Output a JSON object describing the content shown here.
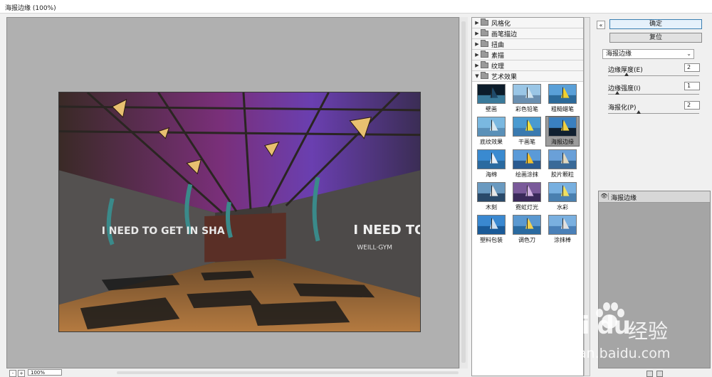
{
  "window": {
    "title": "海报边缘 (100%)"
  },
  "status": {
    "zoom": "100%",
    "zoom_minus": "-",
    "zoom_plus": "+"
  },
  "preview_text": {
    "wall_left": "I NEED TO GET IN SHA",
    "wall_right": "I NEED TO GET I",
    "brand": "WEILL·GYM"
  },
  "gallery": {
    "categories": [
      {
        "label": "风格化",
        "expanded": false
      },
      {
        "label": "画笔描边",
        "expanded": false
      },
      {
        "label": "扭曲",
        "expanded": false
      },
      {
        "label": "素描",
        "expanded": false
      },
      {
        "label": "纹理",
        "expanded": false
      },
      {
        "label": "艺术效果",
        "expanded": true
      }
    ],
    "artistic_filters": [
      {
        "label": "壁画",
        "selected": false
      },
      {
        "label": "彩色铅笔",
        "selected": false
      },
      {
        "label": "粗糙蜡笔",
        "selected": false
      },
      {
        "label": "底纹效果",
        "selected": false
      },
      {
        "label": "干画笔",
        "selected": false
      },
      {
        "label": "海报边缘",
        "selected": true
      },
      {
        "label": "海绵",
        "selected": false
      },
      {
        "label": "绘画涂抹",
        "selected": false
      },
      {
        "label": "胶片颗粒",
        "selected": false
      },
      {
        "label": "木刻",
        "selected": false
      },
      {
        "label": "霓虹灯光",
        "selected": false
      },
      {
        "label": "水彩",
        "selected": false
      },
      {
        "label": "塑料包装",
        "selected": false
      },
      {
        "label": "调色刀",
        "selected": false
      },
      {
        "label": "涂抹棒",
        "selected": false
      }
    ]
  },
  "buttons": {
    "ok": "确定",
    "reset": "复位",
    "collapse": "«"
  },
  "settings": {
    "filter_name": "海报边缘",
    "params": [
      {
        "label": "边缘厚度(E)",
        "value": "2",
        "max": 10
      },
      {
        "label": "边缘强度(I)",
        "value": "1",
        "max": 10
      },
      {
        "label": "海报化(P)",
        "value": "2",
        "max": 6
      }
    ]
  },
  "layers": {
    "items": [
      {
        "name": "海报边缘",
        "visible": true
      }
    ]
  },
  "watermark": {
    "logo": "Bai du",
    "cn": "经验",
    "url": "jingyan.baidu.com"
  },
  "colors": {
    "accent": "#3c7fb1",
    "preview_bg": "#b0b0b0",
    "selected_thumb": "#9c9c9c"
  }
}
